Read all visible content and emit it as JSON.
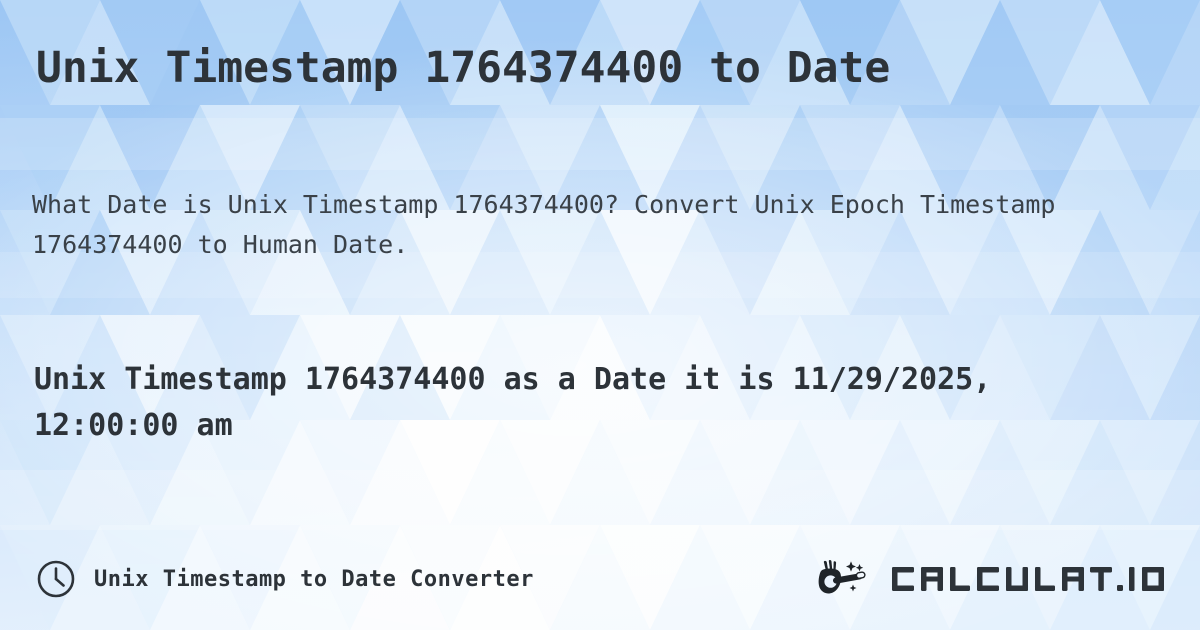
{
  "page": {
    "title": "Unix Timestamp 1764374400 to Date",
    "description": "What Date is Unix Timestamp 1764374400? Convert Unix Epoch Timestamp 1764374400 to Human Date.",
    "result": "Unix Timestamp 1764374400 as a Date it is 11/29/2025, 12:00:00 am",
    "timestamp": "1764374400",
    "human_date": "11/29/2025, 12:00:00 am"
  },
  "footer": {
    "clock_icon": "clock-icon",
    "label": "Unix Timestamp to Date Converter"
  },
  "brand": {
    "mark_icon": "magic-wand-hand-icon",
    "name": "CALCULAT.IO"
  },
  "colors": {
    "background_blue": "#a8cdf5",
    "background_light": "#eaf3fd",
    "text_dark": "#2d3339",
    "text_body": "#3a4148"
  }
}
